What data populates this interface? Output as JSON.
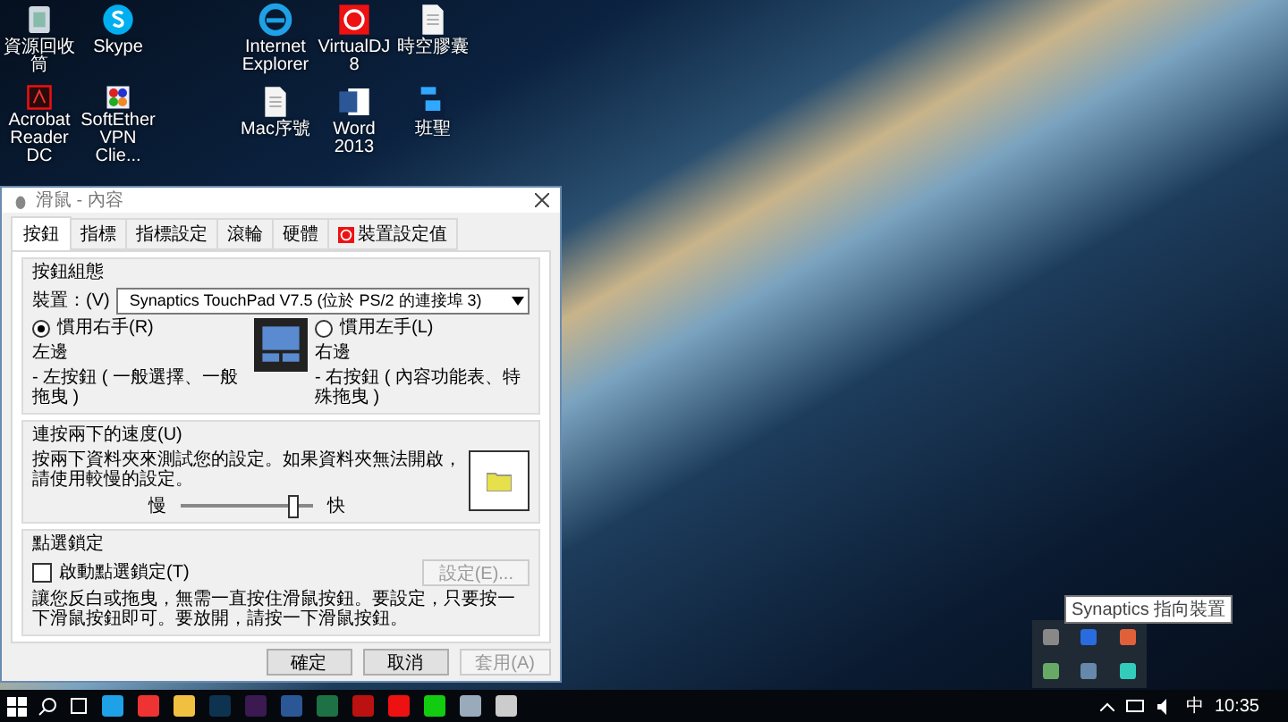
{
  "desktop_icons": [
    {
      "label": "資源回收筒",
      "kind": "recycle"
    },
    {
      "label": "Skype",
      "kind": "skype"
    },
    {
      "label": "Internet Explorer",
      "kind": "ie"
    },
    {
      "label": "VirtualDJ 8",
      "kind": "vdj"
    },
    {
      "label": "時空膠囊",
      "kind": "doc"
    },
    {
      "label": "Acrobat Reader DC",
      "kind": "acrobat"
    },
    {
      "label": "SoftEther VPN Clie...",
      "kind": "softether"
    },
    {
      "label": "Mac序號",
      "kind": "doc"
    },
    {
      "label": "Word 2013",
      "kind": "word"
    },
    {
      "label": "班聖",
      "kind": "psd"
    }
  ],
  "dialog": {
    "title": "滑鼠 - 內容",
    "tabs": [
      {
        "label": "按鈕",
        "selected": true
      },
      {
        "label": "指標",
        "selected": false
      },
      {
        "label": "指標設定",
        "selected": false
      },
      {
        "label": "滾輪",
        "selected": false
      },
      {
        "label": "硬體",
        "selected": false
      },
      {
        "label": "裝置設定值",
        "selected": false,
        "kind": "synaptics"
      }
    ],
    "button_config": {
      "title": "按鈕組態",
      "device_label": "裝置：(V)",
      "device_value": "Synaptics TouchPad V7.5 (位於 PS/2 的連接埠 3)",
      "options": [
        {
          "label": "慣用右手(R)",
          "selected": true,
          "side": "左邊",
          "desc": "- 左按鈕 ( 一般選擇、一般拖曳 )"
        },
        {
          "label": "慣用左手(L)",
          "selected": false,
          "side": "右邊",
          "desc": "- 右按鈕 ( 內容功能表、特殊拖曳 )"
        }
      ]
    },
    "double_click": {
      "title": "連按兩下的速度(U)",
      "text": "按兩下資料夾來測試您的設定。如果資料夾無法開啟，請使用較慢的設定。",
      "slow": "慢",
      "fast": "快",
      "level": 0.85
    },
    "click_lock": {
      "title": "點選鎖定",
      "checkbox": "啟動點選鎖定(T)",
      "checked": false,
      "settings_button": "設定(E)...",
      "settings_disabled": true,
      "text": "讓您反白或拖曳，無需一直按住滑鼠按鈕。要設定，只要按一下滑鼠按鈕即可。要放開，請按一下滑鼠按鈕。"
    },
    "buttons": [
      {
        "label": "確定",
        "disabled": false
      },
      {
        "label": "取消",
        "disabled": false
      },
      {
        "label": "套用(A)",
        "disabled": true
      }
    ]
  },
  "tooltip": "Synaptics 指向裝置",
  "taskbar": {
    "ime": "中",
    "time": "10:35"
  }
}
